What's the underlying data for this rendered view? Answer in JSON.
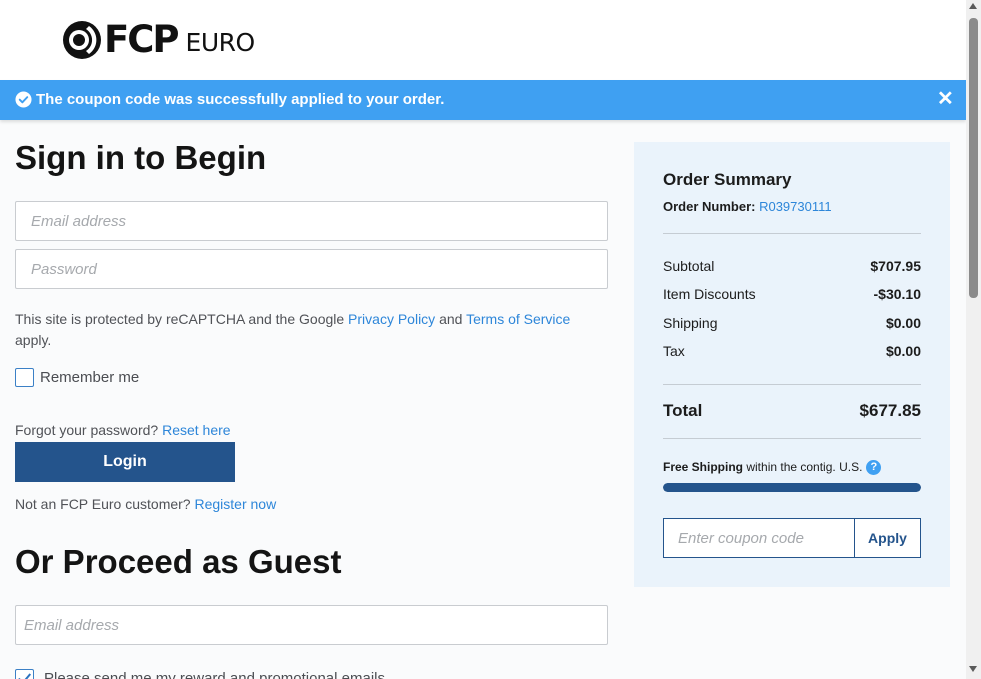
{
  "brand": {
    "name_bold": "FCP",
    "name_light": "EURO"
  },
  "banner": {
    "message": "The coupon code was successfully applied to your order.",
    "close_glyph": "✕",
    "color": "#3fa0f2"
  },
  "signin": {
    "title": "Sign in to Begin",
    "email_placeholder": "Email address",
    "password_placeholder": "Password",
    "recaptcha_prefix": "This site is protected by reCAPTCHA and the Google ",
    "privacy_link": "Privacy Policy",
    "recaptcha_and": " and ",
    "terms_link": "Terms of Service",
    "recaptcha_suffix": "apply.",
    "remember_label": "Remember me",
    "remember_checked": false,
    "forgot_text": "Forgot your password? ",
    "reset_link": "Reset here",
    "login_label": "Login",
    "register_text": "Not an FCP Euro customer? ",
    "register_link": "Register now"
  },
  "guest": {
    "title": "Or Proceed as Guest",
    "email_placeholder": "Email address",
    "promo_label": "Please send me my reward and promotional emails",
    "promo_checked": true
  },
  "summary": {
    "title": "Order Summary",
    "order_number_label": "Order Number: ",
    "order_number": "R039730111",
    "rows": [
      {
        "label": "Subtotal",
        "value": "$707.95"
      },
      {
        "label": "Item Discounts",
        "value": "-$30.10"
      },
      {
        "label": "Shipping",
        "value": "$0.00"
      },
      {
        "label": "Tax",
        "value": "$0.00"
      }
    ],
    "total_label": "Total",
    "total_value": "$677.85",
    "free_shipping_bold": "Free Shipping",
    "free_shipping_rest": " within the contig. U.S.",
    "help_glyph": "?",
    "free_shipping_progress_pct": 100,
    "coupon_placeholder": "Enter coupon code",
    "apply_label": "Apply"
  },
  "colors": {
    "primary": "#24548c",
    "link": "#2d86d9",
    "summary_bg": "#eaf3fb"
  },
  "icons": {
    "banner": "check-circle-icon",
    "close": "close-icon",
    "help": "question-circle-icon"
  }
}
